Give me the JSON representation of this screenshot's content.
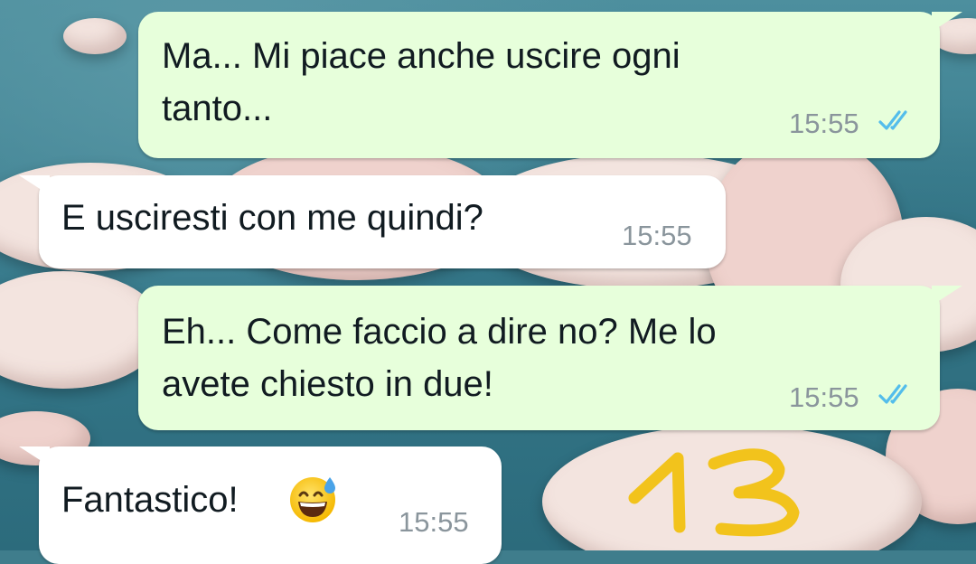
{
  "messages": [
    {
      "direction": "outgoing",
      "text_lines": [
        "Ma... Mi piace anche uscire ogni",
        "tanto..."
      ],
      "time": "15:55",
      "status": "read-double-check-icon"
    },
    {
      "direction": "incoming",
      "text_lines": [
        "E usciresti con me quindi?"
      ],
      "time": "15:55"
    },
    {
      "direction": "outgoing",
      "text_lines": [
        "Eh... Come faccio a dire no? Me lo",
        "avete chiesto in due!"
      ],
      "time": "15:55",
      "status": "read-double-check-icon"
    },
    {
      "direction": "incoming",
      "text_lines": [
        "Fantastico!"
      ],
      "emoji": "grinning-sweat-emoji",
      "time": "15:55"
    }
  ],
  "annotation": {
    "text": "13",
    "color": "#f2c31c"
  },
  "colors": {
    "outgoing_bubble": "#e7ffdb",
    "incoming_bubble": "#ffffff",
    "read_tick": "#53bdeb",
    "timestamp": "#8a959c"
  }
}
